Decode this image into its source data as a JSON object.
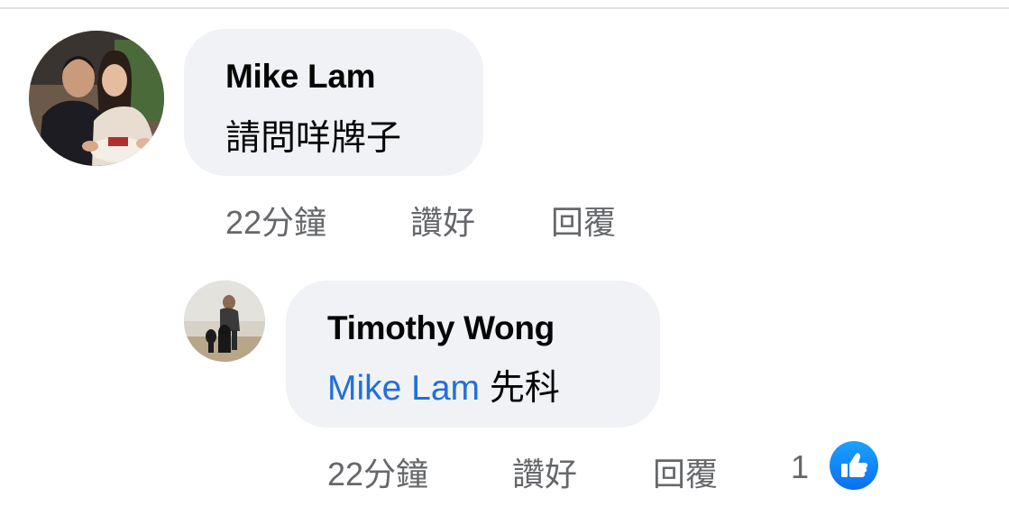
{
  "comments": [
    {
      "author": "Mike Lam",
      "text": "請問咩牌子",
      "time": "22分鐘",
      "like_label": "讚好",
      "reply_label": "回覆"
    }
  ],
  "replies": [
    {
      "author": "Timothy Wong",
      "mention": "Mike Lam",
      "text": "先科",
      "time": "22分鐘",
      "like_label": "讚好",
      "reply_label": "回覆",
      "reaction_count": "1",
      "reaction_icon": "like-thumbs-up-icon"
    }
  ],
  "colors": {
    "bubble_bg": "#f0f2f5",
    "mention": "#216fdb",
    "meta_text": "#65676b",
    "like_blue": "#1877f2"
  }
}
